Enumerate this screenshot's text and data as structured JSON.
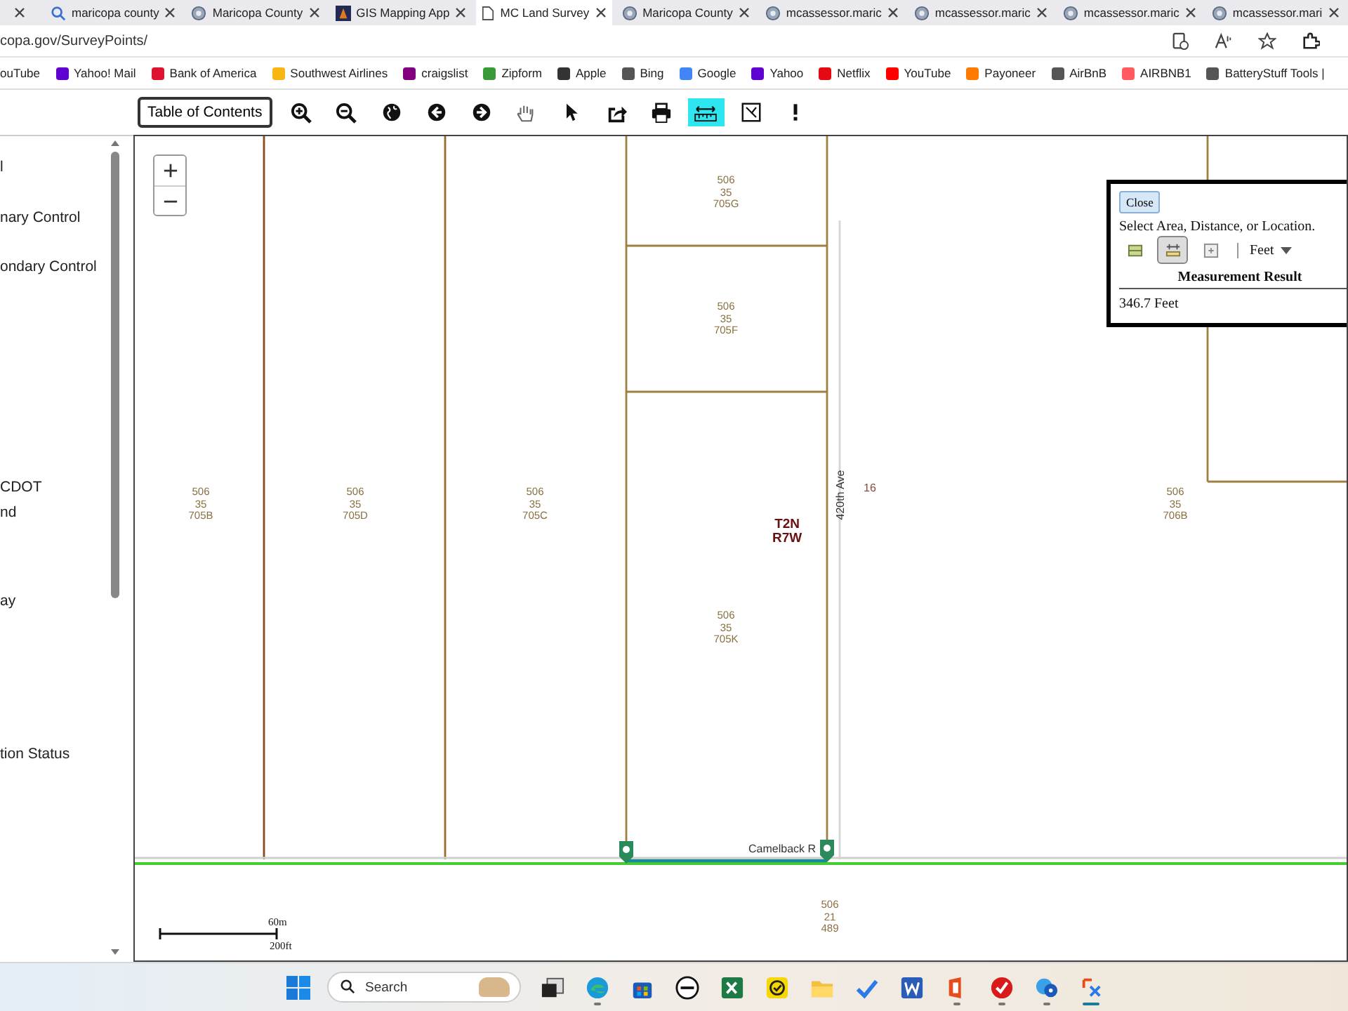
{
  "browser_tabs": [
    {
      "label": "maricopa county",
      "kind": "search",
      "selected": false
    },
    {
      "label": "Maricopa County",
      "kind": "globe",
      "selected": false
    },
    {
      "label": "GIS Mapping App",
      "kind": "app",
      "selected": false
    },
    {
      "label": "MC Land Survey",
      "kind": "page",
      "selected": true
    },
    {
      "label": "Maricopa County",
      "kind": "globe",
      "selected": false
    },
    {
      "label": "mcassessor.maric",
      "kind": "globe",
      "selected": false
    },
    {
      "label": "mcassessor.maric",
      "kind": "globe",
      "selected": false
    },
    {
      "label": "mcassessor.maric",
      "kind": "globe",
      "selected": false
    },
    {
      "label": "mcassessor.mari",
      "kind": "globe",
      "selected": false
    }
  ],
  "address_bar": {
    "url": "copa.gov/SurveyPoints/"
  },
  "bookmarks": [
    {
      "label": "ouTube"
    },
    {
      "label": "Yahoo! Mail",
      "color": "#6001d2"
    },
    {
      "label": "Bank of America",
      "color": "#dc1431"
    },
    {
      "label": "Southwest Airlines",
      "color": "#f9b612"
    },
    {
      "label": "craigslist",
      "color": "#800080"
    },
    {
      "label": "Zipform",
      "color": "#3a9a3a"
    },
    {
      "label": "Apple",
      "color": "#333333"
    },
    {
      "label": "Bing",
      "color": "#555555"
    },
    {
      "label": "Google",
      "color": "#4285f4"
    },
    {
      "label": "Yahoo",
      "color": "#6001d2"
    },
    {
      "label": "Netflix",
      "color": "#e50914"
    },
    {
      "label": "YouTube",
      "color": "#ff0000"
    },
    {
      "label": "Payoneer",
      "color": "#ff7a00"
    },
    {
      "label": "AirBnB",
      "color": "#555555"
    },
    {
      "label": "AIRBNB1",
      "color": "#ff5a5f"
    },
    {
      "label": "BatteryStuff Tools |",
      "color": "#555555"
    }
  ],
  "sidebar": {
    "items": [
      "l",
      "nary Control",
      "ondary Control",
      "CDOT",
      "nd",
      "ay",
      "tion Status"
    ]
  },
  "toolbar": {
    "toc_button": "Table of Contents",
    "tools": [
      {
        "kind": "zoom-in",
        "selected": false
      },
      {
        "kind": "zoom-out",
        "selected": false
      },
      {
        "kind": "globe",
        "selected": false
      },
      {
        "kind": "back",
        "selected": false
      },
      {
        "kind": "forward",
        "selected": false
      },
      {
        "kind": "pan",
        "selected": false
      },
      {
        "kind": "pointer",
        "selected": false
      },
      {
        "kind": "share",
        "selected": false
      },
      {
        "kind": "print",
        "selected": false
      },
      {
        "kind": "measure",
        "selected": true
      },
      {
        "kind": "extent",
        "selected": false
      },
      {
        "kind": "info",
        "selected": false
      }
    ]
  },
  "map": {
    "parcels": [
      {
        "lines": [
          "506",
          "35",
          "705B"
        ]
      },
      {
        "lines": [
          "506",
          "35",
          "705D"
        ]
      },
      {
        "lines": [
          "506",
          "35",
          "705C"
        ]
      },
      {
        "lines": [
          "506",
          "35",
          "705G"
        ]
      },
      {
        "lines": [
          "506",
          "35",
          "705F"
        ]
      },
      {
        "lines": [
          "506",
          "35",
          "705K"
        ]
      },
      {
        "lines": [
          "506",
          "35",
          "706B"
        ]
      },
      {
        "lines": [
          "506",
          "21",
          "489"
        ]
      }
    ],
    "section_number": "16",
    "township": [
      "T2N",
      "R7W"
    ],
    "road_labels": [
      "420th Ave",
      "Camelback R"
    ],
    "scale": {
      "metric": "60m",
      "imperial": "200ft"
    }
  },
  "measure_panel": {
    "close": "Close",
    "instruction": "Select Area, Distance, or Location.",
    "tools": [
      {
        "kind": "area",
        "selected": false
      },
      {
        "kind": "distance",
        "selected": true
      },
      {
        "kind": "location",
        "selected": false
      }
    ],
    "unit": "Feet",
    "heading": "Measurement Result",
    "result": "346.7 Feet"
  },
  "taskbar": {
    "search_placeholder": "Search",
    "apps": [
      {
        "kind": "task-view",
        "running": false
      },
      {
        "kind": "edge",
        "running": true
      },
      {
        "kind": "store",
        "running": false
      },
      {
        "kind": "dell",
        "running": false
      },
      {
        "kind": "excel",
        "running": false
      },
      {
        "kind": "check-badge",
        "running": false
      },
      {
        "kind": "folder",
        "running": false
      },
      {
        "kind": "todo",
        "running": false
      },
      {
        "kind": "word",
        "running": false
      },
      {
        "kind": "office",
        "running": true
      },
      {
        "kind": "check-circle",
        "running": true
      },
      {
        "kind": "help",
        "running": true
      },
      {
        "kind": "snip",
        "running": true
      }
    ]
  }
}
